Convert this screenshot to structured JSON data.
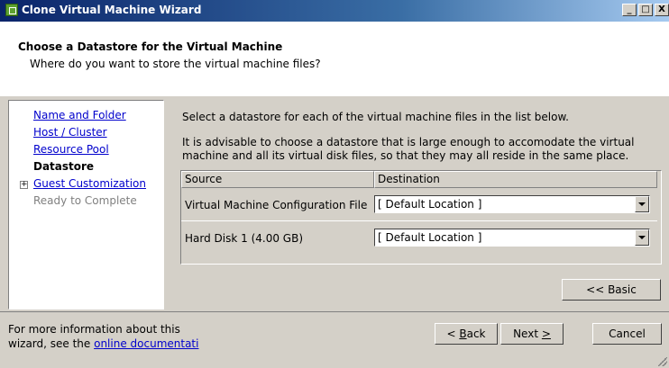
{
  "window": {
    "title": "Clone Virtual Machine Wizard",
    "buttons": {
      "minimize": "_",
      "maximize": "□",
      "close": "X"
    }
  },
  "header": {
    "title": "Choose a Datastore for the Virtual Machine",
    "subtitle": "Where do you want to store the virtual machine files?"
  },
  "sidebar": {
    "items": [
      {
        "label": "Name and Folder",
        "state": "link"
      },
      {
        "label": "Host / Cluster",
        "state": "link"
      },
      {
        "label": "Resource Pool",
        "state": "link"
      },
      {
        "label": "Datastore",
        "state": "current"
      },
      {
        "label": "Guest Customization",
        "state": "link",
        "expander": "+"
      },
      {
        "label": "Ready to Complete",
        "state": "disabled"
      }
    ]
  },
  "main": {
    "instruction": "Select a datastore for each of the virtual machine files in the list below.",
    "advice_line1": "It is advisable to choose a datastore that is large enough to accomodate the virtual",
    "advice_line2": "machine and all its virtual disk files, so that they may all reside in the same place.",
    "table": {
      "columns": [
        "Source",
        "Destination"
      ],
      "rows": [
        {
          "source": "Virtual Machine Configuration File",
          "destination": "[ Default Location ]"
        },
        {
          "source": "Hard Disk 1 (4.00 GB)",
          "destination": "[ Default Location ]"
        }
      ]
    },
    "basic_button": "<< Basic"
  },
  "footer": {
    "info_line1": "For more information about this",
    "info_line2_prefix": "wizard,  see the ",
    "doc_link": "online documentati",
    "back_button": {
      "mnemonic": "B",
      "rest": "ack",
      "prefix": "< "
    },
    "next_button": {
      "label_prefix": "Next ",
      "mnemonic": ">"
    },
    "cancel_button": "Cancel"
  },
  "colors": {
    "titlebar_start": "#0a246a",
    "titlebar_end": "#a6caf0",
    "dialog_face": "#d4d0c8",
    "link": "#0000cc"
  }
}
